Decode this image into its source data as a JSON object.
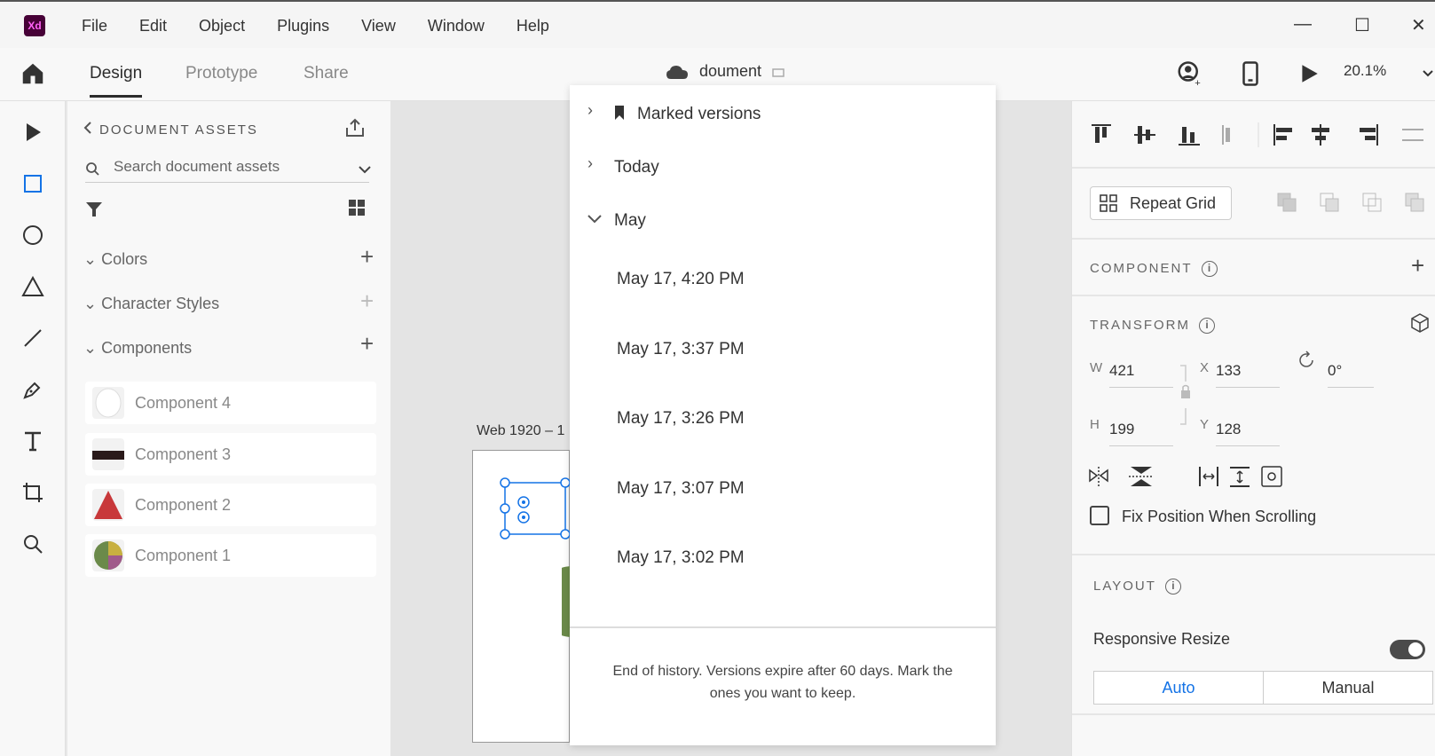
{
  "app": {
    "logo": "Xd",
    "menu": [
      "File",
      "Edit",
      "Object",
      "Plugins",
      "View",
      "Window",
      "Help"
    ]
  },
  "window_controls": {
    "minimize": "—",
    "maximize": "☐",
    "close": "✕"
  },
  "header": {
    "tabs": [
      "Design",
      "Prototype",
      "Share"
    ],
    "active_tab": "Design",
    "document_title": "doument",
    "zoom": "20.1%"
  },
  "assets": {
    "title": "DOCUMENT ASSETS",
    "search_placeholder": "Search document assets",
    "sections": [
      "Colors",
      "Character Styles",
      "Components"
    ],
    "components": [
      "Component 4",
      "Component 3",
      "Component 2",
      "Component 1"
    ]
  },
  "canvas": {
    "artboard_label": "Web 1920 – 1"
  },
  "history": {
    "marked": "Marked versions",
    "today": "Today",
    "month": "May",
    "versions": [
      "May 17, 4:20 PM",
      "May 17, 3:37 PM",
      "May 17, 3:26 PM",
      "May 17, 3:07 PM",
      "May 17, 3:02 PM"
    ],
    "footer": "End of history. Versions expire after 60 days. Mark the ones you want to keep."
  },
  "props": {
    "repeat_grid": "Repeat Grid",
    "component_label": "COMPONENT",
    "transform_label": "TRANSFORM",
    "w_label": "W",
    "w": "421",
    "x_label": "X",
    "x": "133",
    "h_label": "H",
    "h": "199",
    "y_label": "Y",
    "y": "128",
    "rotation": "0°",
    "fix_position": "Fix Position When Scrolling",
    "layout_label": "LAYOUT",
    "responsive_resize": "Responsive Resize",
    "resize_modes": [
      "Auto",
      "Manual"
    ],
    "accent": "#1473e6"
  }
}
